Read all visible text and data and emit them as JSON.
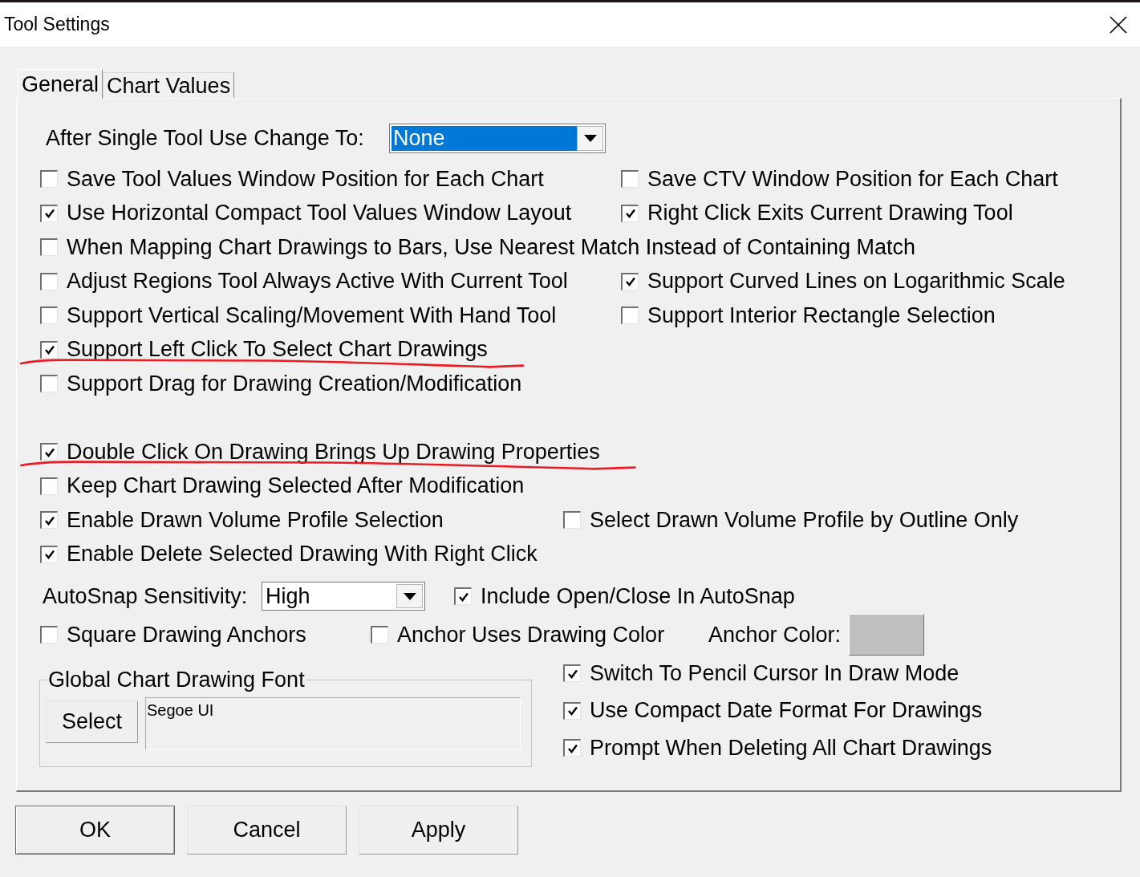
{
  "window": {
    "title": "Tool Settings"
  },
  "tabs": [
    {
      "label": "General",
      "selected": true
    },
    {
      "label": "Chart Values",
      "selected": false
    }
  ],
  "after_single_tool_use": {
    "label": "After Single Tool Use Change To:",
    "value": "None",
    "focused": true
  },
  "option_rows_top": [
    {
      "items": [
        {
          "label": "Save Tool Values Window Position for Each Chart",
          "checked": false,
          "pen_underlined": false
        },
        {
          "label": "Save CTV Window Position for Each Chart",
          "checked": false,
          "pen_underlined": false
        }
      ]
    },
    {
      "items": [
        {
          "label": "Use Horizontal Compact Tool Values Window Layout",
          "checked": true,
          "pen_underlined": false
        },
        {
          "label": "Right Click Exits Current Drawing Tool",
          "checked": true,
          "pen_underlined": false
        }
      ]
    },
    {
      "items": [
        {
          "label": "When Mapping Chart Drawings to Bars, Use Nearest Match Instead of Containing Match",
          "checked": false,
          "pen_underlined": false
        }
      ]
    },
    {
      "items": [
        {
          "label": "Adjust Regions Tool Always Active With Current Tool",
          "checked": false,
          "pen_underlined": false
        },
        {
          "label": "Support Curved Lines on Logarithmic Scale",
          "checked": true,
          "pen_underlined": false
        }
      ]
    },
    {
      "items": [
        {
          "label": "Support Vertical Scaling/Movement With Hand Tool",
          "checked": false,
          "pen_underlined": false
        },
        {
          "label": "Support Interior Rectangle Selection",
          "checked": false,
          "pen_underlined": false
        }
      ]
    },
    {
      "items": [
        {
          "label": "Support Left Click To Select Chart Drawings",
          "checked": true,
          "pen_underlined": true
        }
      ]
    },
    {
      "items": [
        {
          "label": "Support Drag for Drawing Creation/Modification",
          "checked": false,
          "pen_underlined": false
        }
      ]
    }
  ],
  "option_rows_middle": [
    {
      "items": [
        {
          "label": "Double Click On Drawing Brings Up Drawing Properties",
          "checked": true,
          "pen_underlined": true
        }
      ]
    },
    {
      "items": [
        {
          "label": "Keep Chart Drawing Selected After Modification",
          "checked": false,
          "pen_underlined": false
        }
      ]
    },
    {
      "items": [
        {
          "label": "Enable Drawn Volume Profile Selection",
          "checked": true,
          "pen_underlined": false
        },
        {
          "label": "Select Drawn Volume Profile by Outline Only",
          "checked": false,
          "pen_underlined": false
        }
      ]
    },
    {
      "items": [
        {
          "label": "Enable Delete Selected Drawing With Right Click",
          "checked": true,
          "pen_underlined": false
        }
      ]
    }
  ],
  "autosnap": {
    "label": "AutoSnap Sensitivity:",
    "value": "High",
    "focused": false
  },
  "include_open_close": {
    "label": "Include Open/Close In AutoSnap",
    "checked": true,
    "pen_underlined": false
  },
  "anchor_options": [
    {
      "label": "Square Drawing Anchors",
      "checked": false,
      "pen_underlined": false
    },
    {
      "label": "Anchor Uses Drawing Color",
      "checked": false,
      "pen_underlined": false
    }
  ],
  "anchor_color": {
    "label": "Anchor Color:",
    "color": "#c0c0c0"
  },
  "font_group": {
    "title": "Global Chart Drawing Font",
    "button": "Select",
    "value": "Segoe UI"
  },
  "right_options": [
    {
      "label": "Switch To Pencil Cursor In Draw Mode",
      "checked": true,
      "pen_underlined": false
    },
    {
      "label": "Use Compact Date Format For Drawings",
      "checked": true,
      "pen_underlined": false
    },
    {
      "label": "Prompt When Deleting All Chart Drawings",
      "checked": true,
      "pen_underlined": false
    }
  ],
  "buttons": [
    {
      "label": "OK",
      "default": true
    },
    {
      "label": "Cancel",
      "default": false
    },
    {
      "label": "Apply",
      "default": false
    }
  ]
}
